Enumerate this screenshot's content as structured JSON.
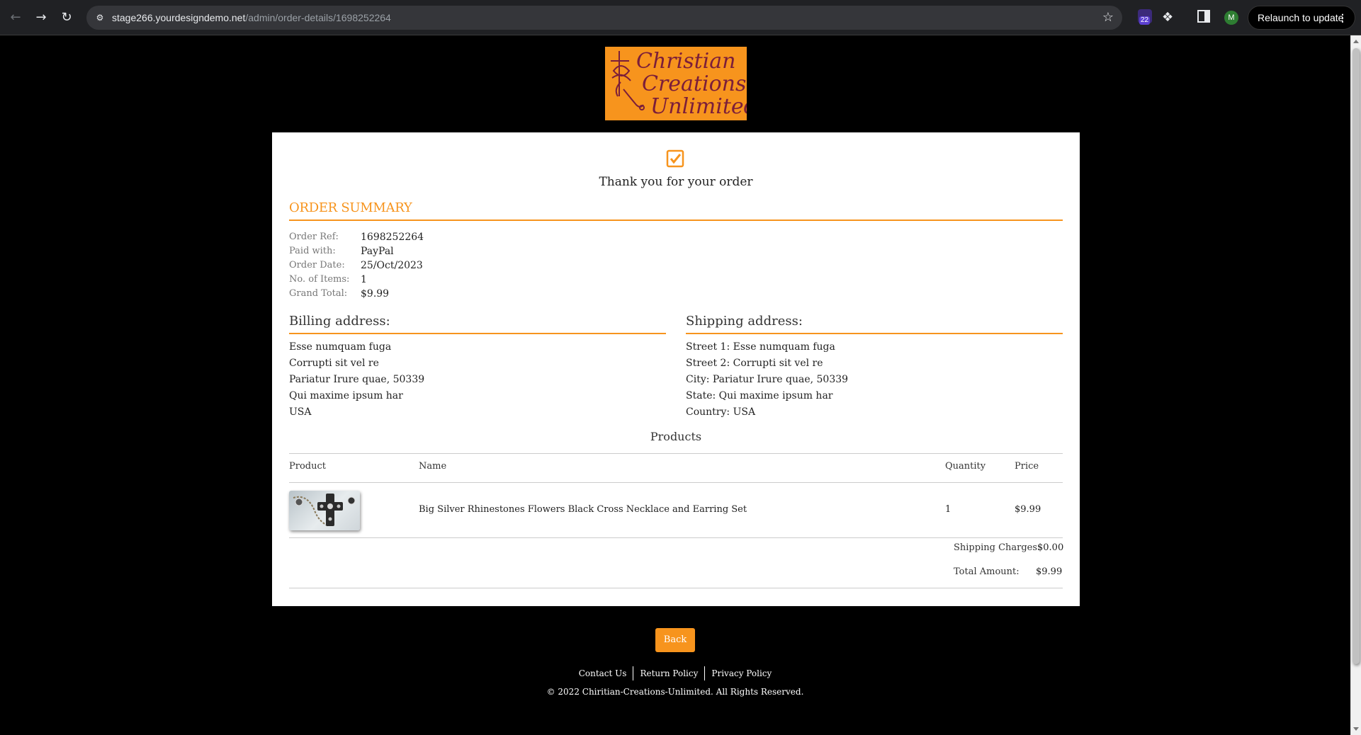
{
  "browser": {
    "url_host": "stage266.yourdesigndemo.net",
    "url_path": "/admin/order-details/1698252264",
    "extension_badge": "22",
    "profile_initial": "M",
    "relaunch_label": "Relaunch to update"
  },
  "logo": {
    "lines": [
      "Christian",
      "Creations",
      "Unlimited"
    ]
  },
  "confirmation": {
    "message": "Thank you for your order"
  },
  "summary": {
    "title": "ORDER SUMMARY",
    "fields": [
      {
        "label": "Order Ref:",
        "value": "1698252264"
      },
      {
        "label": "Paid with:",
        "value": "PayPal"
      },
      {
        "label": "Order Date:",
        "value": "25/Oct/2023"
      },
      {
        "label": "No. of Items:",
        "value": "1"
      },
      {
        "label": "Grand Total:",
        "value": "$9.99"
      }
    ]
  },
  "billing": {
    "title": "Billing address:",
    "lines": [
      "Esse numquam fuga",
      "Corrupti sit vel re",
      "Pariatur Irure quae, 50339",
      "Qui maxime ipsum har",
      "USA"
    ]
  },
  "shipping": {
    "title": "Shipping address:",
    "lines": [
      "Street 1: Esse numquam fuga",
      "Street 2: Corrupti sit vel re",
      "City: Pariatur Irure quae, 50339",
      "State: Qui maxime ipsum har",
      "Country: USA"
    ]
  },
  "products": {
    "title": "Products",
    "columns": [
      "Product",
      "Name",
      "Quantity",
      "Price"
    ],
    "rows": [
      {
        "name": "Big Silver Rhinestones Flowers Black Cross Necklace and Earring Set",
        "quantity": "1",
        "price": "$9.99"
      }
    ]
  },
  "totals": {
    "shipping_label": "Shipping Charges:",
    "shipping_value": "$0.00",
    "total_label": "Total Amount:",
    "total_value": "$9.99"
  },
  "actions": {
    "back_label": "Back"
  },
  "footer": {
    "links": [
      "Contact Us",
      "Return Policy",
      "Privacy Policy"
    ],
    "copyright": "© 2022 Chiritian-Creations-Unlimited. All Rights Reserved."
  },
  "colors": {
    "accent": "#f7941d",
    "logo_text": "#7b1e3a",
    "page_background": "#000000",
    "card_background": "#ffffff"
  }
}
